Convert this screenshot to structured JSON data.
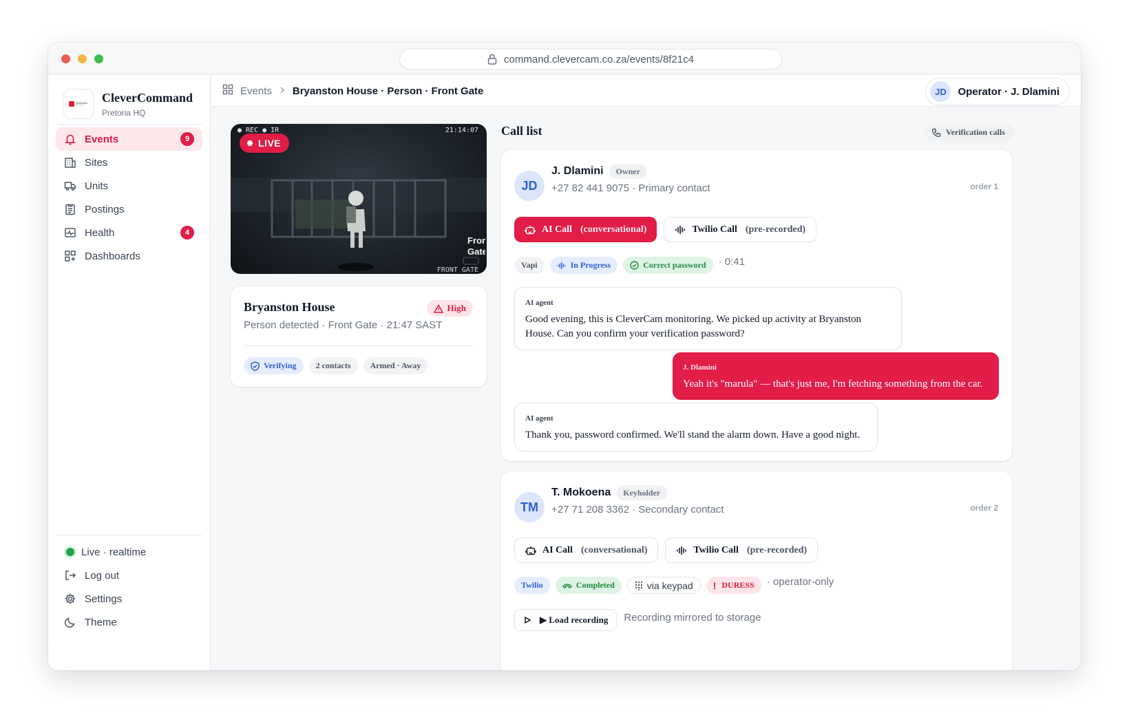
{
  "browser": {
    "url": "command.clevercam.co.za/events/8f21c4"
  },
  "brand": {
    "name": "CleverCommand",
    "location": "Pretoria HQ"
  },
  "nav": [
    {
      "label": "Events",
      "icon": "bell-icon",
      "badge": "9",
      "active": true
    },
    {
      "label": "Sites",
      "icon": "building-icon"
    },
    {
      "label": "Units",
      "icon": "truck-icon"
    },
    {
      "label": "Postings",
      "icon": "clipboard-icon"
    },
    {
      "label": "Health",
      "icon": "pulse-icon",
      "badge": "4"
    },
    {
      "label": "Dashboards",
      "icon": "dashboard-icon"
    }
  ],
  "bottom_nav": {
    "status": "Live · realtime",
    "logout": "Log out",
    "settings": "Settings",
    "theme": "Theme"
  },
  "topbar": {
    "crumb_root": "Events",
    "crumb_current": "Bryanston House · Person · Front Gate",
    "operator_initials": "JD",
    "operator_label": "Operator · J. Dlamini"
  },
  "camera": {
    "overlay_left": "● REC ● IR",
    "timestamp": "21:14:07",
    "live_label": "LIVE",
    "camera_label_line1": "Front",
    "camera_label_line2": "Gate",
    "footer_label": "FRONT GATE"
  },
  "event": {
    "title": "Bryanston House",
    "subtitle": "Person detected · Front Gate · 21:47 SAST",
    "severity": "High",
    "tags": {
      "status": "Verifying",
      "contacts": "2 contacts",
      "arm_state": "Armed · Away"
    }
  },
  "call_list": {
    "title": "Call list",
    "badge": "Verification calls",
    "contacts": [
      {
        "initials": "JD",
        "name": "J. Dlamini",
        "role": "Owner",
        "phone": "+27 82 441 9075 · Primary contact",
        "order": "order 1",
        "ai_call": {
          "label": "AI Call",
          "mode": "(conversational)"
        },
        "twilio_call": {
          "label": "Twilio Call",
          "mode": "(pre-recorded)"
        },
        "status": {
          "provider": "Vapi",
          "state": "In Progress",
          "result": "Correct password",
          "duration": "· 0:41"
        },
        "transcript": [
          {
            "who": "AI agent",
            "text": "Good evening, this is CleverCam monitoring. We picked up activity at Bryanston House. Can you confirm your verification password?"
          },
          {
            "who": "J. Dlamini",
            "text": "Yeah it's \"marula\" — that's just me, I'm fetching something from the car."
          },
          {
            "who": "AI agent",
            "text": "Thank you, password confirmed. We'll stand the alarm down. Have a good night."
          }
        ]
      },
      {
        "initials": "TM",
        "name": "T. Mokoena",
        "role": "Keyholder",
        "phone": "+27 71 208 3362 · Secondary contact",
        "order": "order 2",
        "ai_call": {
          "label": "AI Call",
          "mode": "(conversational)"
        },
        "twilio_call": {
          "label": "Twilio Call",
          "mode": "(pre-recorded)"
        },
        "status": {
          "provider": "Twilio",
          "state": "Completed",
          "method": "via keypad",
          "flag": "DURESS",
          "note": "· operator-only"
        },
        "recording": {
          "button": "▶ Load recording",
          "note": "Recording mirrored to storage"
        }
      }
    ]
  },
  "colors": {
    "accent": "#e11d48",
    "info": "#2f5fd0",
    "success": "#1f8a3f",
    "live": "#22a447"
  }
}
